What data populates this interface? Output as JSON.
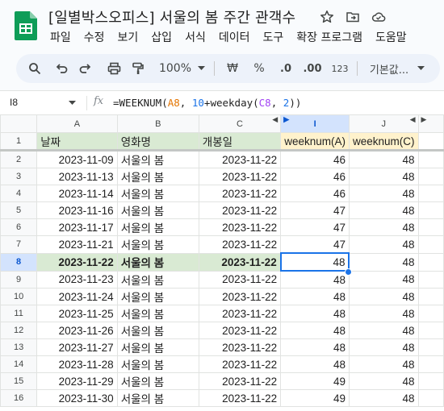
{
  "doc": {
    "title": "[일별박스오피스] 서울의 봄 주간 관객수"
  },
  "menu": [
    "파일",
    "수정",
    "보기",
    "삽입",
    "서식",
    "데이터",
    "도구",
    "확장 프로그램",
    "도움말"
  ],
  "toolbar": {
    "zoom": "100%",
    "currency": "₩",
    "percent": "%",
    "dec_less": ".0",
    "dec_more": ".00",
    "number_format": "123",
    "font": "기본값..."
  },
  "formula_bar": {
    "cell_ref": "I8",
    "fx": "fx",
    "formula_prefix": "=WEEKNUM(",
    "ref1": "A8",
    "sep1": ", ",
    "num": "10",
    "mid": "+weekday(",
    "ref2": "C8",
    "sep2": ", ",
    "num2": "2",
    "suffix": "))"
  },
  "columns": [
    "A",
    "B",
    "C",
    "I",
    "J"
  ],
  "header_row": {
    "num": "1",
    "a": "날짜",
    "b": "영화명",
    "c": "개봉일",
    "i": "weeknum(A)",
    "j": "weeknum(C)"
  },
  "rows": [
    {
      "num": "2",
      "a": "2023-11-09",
      "b": "서울의 봄",
      "c": "2023-11-22",
      "i": "46",
      "j": "48"
    },
    {
      "num": "3",
      "a": "2023-11-13",
      "b": "서울의 봄",
      "c": "2023-11-22",
      "i": "46",
      "j": "48"
    },
    {
      "num": "4",
      "a": "2023-11-14",
      "b": "서울의 봄",
      "c": "2023-11-22",
      "i": "46",
      "j": "48"
    },
    {
      "num": "5",
      "a": "2023-11-16",
      "b": "서울의 봄",
      "c": "2023-11-22",
      "i": "47",
      "j": "48"
    },
    {
      "num": "6",
      "a": "2023-11-17",
      "b": "서울의 봄",
      "c": "2023-11-22",
      "i": "47",
      "j": "48"
    },
    {
      "num": "7",
      "a": "2023-11-21",
      "b": "서울의 봄",
      "c": "2023-11-22",
      "i": "47",
      "j": "48"
    },
    {
      "num": "8",
      "a": "2023-11-22",
      "b": "서울의 봄",
      "c": "2023-11-22",
      "i": "48",
      "j": "48"
    },
    {
      "num": "9",
      "a": "2023-11-23",
      "b": "서울의 봄",
      "c": "2023-11-22",
      "i": "48",
      "j": "48"
    },
    {
      "num": "10",
      "a": "2023-11-24",
      "b": "서울의 봄",
      "c": "2023-11-22",
      "i": "48",
      "j": "48"
    },
    {
      "num": "11",
      "a": "2023-11-25",
      "b": "서울의 봄",
      "c": "2023-11-22",
      "i": "48",
      "j": "48"
    },
    {
      "num": "12",
      "a": "2023-11-26",
      "b": "서울의 봄",
      "c": "2023-11-22",
      "i": "48",
      "j": "48"
    },
    {
      "num": "13",
      "a": "2023-11-27",
      "b": "서울의 봄",
      "c": "2023-11-22",
      "i": "48",
      "j": "48"
    },
    {
      "num": "14",
      "a": "2023-11-28",
      "b": "서울의 봄",
      "c": "2023-11-22",
      "i": "48",
      "j": "48"
    },
    {
      "num": "15",
      "a": "2023-11-29",
      "b": "서울의 봄",
      "c": "2023-11-22",
      "i": "49",
      "j": "48"
    },
    {
      "num": "16",
      "a": "2023-11-30",
      "b": "서울의 봄",
      "c": "2023-11-22",
      "i": "49",
      "j": "48"
    }
  ],
  "colors": {
    "accent": "#1a73e8",
    "header_green": "#d9ead3",
    "header_yellow": "#fff2cc",
    "formula_ref": "#e37400"
  },
  "icons": [
    "sheets-logo-icon",
    "star-icon",
    "move-folder-icon",
    "cloud-icon",
    "search-icon",
    "undo-icon",
    "redo-icon",
    "print-icon",
    "paint-format-icon",
    "dropdown-icon"
  ]
}
